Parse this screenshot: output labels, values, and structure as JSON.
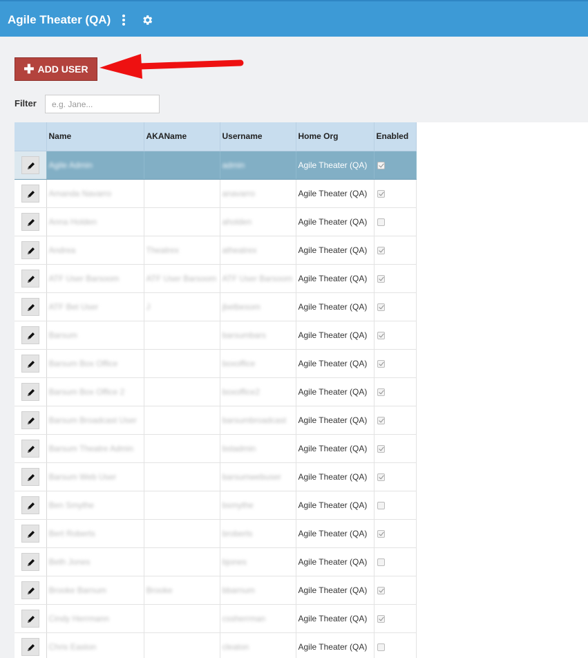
{
  "header": {
    "title": "Agile Theater (QA)",
    "menu_icon": "kebab-icon",
    "settings_icon": "gear-icon"
  },
  "toolbar": {
    "add_user_label": "ADD USER",
    "add_user_icon": "plus-icon"
  },
  "filter": {
    "label": "Filter",
    "placeholder": "e.g. Jane...",
    "value": ""
  },
  "table": {
    "columns": [
      "Name",
      "AKAName",
      "Username",
      "Home Org",
      "Enabled"
    ],
    "rows": [
      {
        "name": "Agile Admin",
        "aka": "",
        "username": "admin",
        "org": "Agile Theater (QA)",
        "enabled": true,
        "selected": true
      },
      {
        "name": "Amanda Navarro",
        "aka": "",
        "username": "anavarro",
        "org": "Agile Theater (QA)",
        "enabled": true
      },
      {
        "name": "Anna Holden",
        "aka": "",
        "username": "aholden",
        "org": "Agile Theater (QA)",
        "enabled": false
      },
      {
        "name": "Andrea",
        "aka": "Theatrex",
        "username": "atheatrex",
        "org": "Agile Theater (QA)",
        "enabled": true
      },
      {
        "name": "ATF User Barsoom",
        "aka": "ATF User Barsoom",
        "username": "ATF User Barsoom",
        "org": "Agile Theater (QA)",
        "enabled": true
      },
      {
        "name": "ATF Bet User",
        "aka": "J",
        "username": "jbetbesom",
        "org": "Agile Theater (QA)",
        "enabled": true
      },
      {
        "name": "Barsum",
        "aka": "",
        "username": "barsumbars",
        "org": "Agile Theater (QA)",
        "enabled": true
      },
      {
        "name": "Barsum Box Office",
        "aka": "",
        "username": "boxoffice",
        "org": "Agile Theater (QA)",
        "enabled": true
      },
      {
        "name": "Barsum Box Office 2",
        "aka": "",
        "username": "boxoffice2",
        "org": "Agile Theater (QA)",
        "enabled": true
      },
      {
        "name": "Barsum Broadcast User",
        "aka": "",
        "username": "barsumbroadcast",
        "org": "Agile Theater (QA)",
        "enabled": true
      },
      {
        "name": "Barsum Theatre Admin",
        "aka": "",
        "username": "bstadmin",
        "org": "Agile Theater (QA)",
        "enabled": true
      },
      {
        "name": "Barsum Web User",
        "aka": "",
        "username": "barsumwebuser",
        "org": "Agile Theater (QA)",
        "enabled": true
      },
      {
        "name": "Ben Smythe",
        "aka": "",
        "username": "bsmythe",
        "org": "Agile Theater (QA)",
        "enabled": false
      },
      {
        "name": "Bert Roberts",
        "aka": "",
        "username": "broberts",
        "org": "Agile Theater (QA)",
        "enabled": true
      },
      {
        "name": "Beth Jones",
        "aka": "",
        "username": "bjones",
        "org": "Agile Theater (QA)",
        "enabled": false
      },
      {
        "name": "Brooke Barnum",
        "aka": "Brooke",
        "username": "bbarnum",
        "org": "Agile Theater (QA)",
        "enabled": true
      },
      {
        "name": "Cindy Herrmann",
        "aka": "",
        "username": "cssherrman",
        "org": "Agile Theater (QA)",
        "enabled": true
      },
      {
        "name": "Chris Easton",
        "aka": "",
        "username": "cleaton",
        "org": "Agile Theater (QA)",
        "enabled": false
      }
    ]
  },
  "colors": {
    "header": "#3d9ad6",
    "add_button": "#b3433d",
    "table_header": "#c8ddee",
    "selected_row": "#82afc5",
    "annotation_arrow": "#ee1111"
  }
}
